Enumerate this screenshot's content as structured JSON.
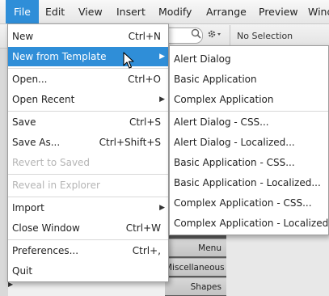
{
  "menubar": {
    "items": [
      "File",
      "Edit",
      "View",
      "Insert",
      "Modify",
      "Arrange",
      "Preview",
      "Wind"
    ]
  },
  "toolbar": {
    "no_selection": "No Selection"
  },
  "background_panel": {
    "items": [
      "Menu",
      "Miscellaneous",
      "Shapes"
    ]
  },
  "file_menu": {
    "items": [
      {
        "label": "New",
        "shortcut": "Ctrl+N"
      },
      {
        "label": "New from Template",
        "shortcut": "",
        "submenu": true,
        "highlighted": true
      },
      {
        "label": "Open...",
        "shortcut": "Ctrl+O"
      },
      {
        "label": "Open Recent",
        "shortcut": "",
        "submenu": true
      },
      {
        "label": "Save",
        "shortcut": "Ctrl+S"
      },
      {
        "label": "Save As...",
        "shortcut": "Ctrl+Shift+S"
      },
      {
        "label": "Revert to Saved",
        "shortcut": "",
        "disabled": true
      },
      {
        "label": "Reveal in Explorer",
        "shortcut": "",
        "disabled": true
      },
      {
        "label": "Import",
        "shortcut": "",
        "submenu": true
      },
      {
        "label": "Close Window",
        "shortcut": "Ctrl+W"
      },
      {
        "label": "Preferences...",
        "shortcut": "Ctrl+,"
      },
      {
        "label": "Quit",
        "shortcut": ""
      }
    ]
  },
  "template_submenu": {
    "items": [
      "Alert Dialog",
      "Basic Application",
      "Complex Application",
      "Alert Dialog - CSS...",
      "Alert Dialog - Localized...",
      "Basic Application - CSS...",
      "Basic Application - Localized...",
      "Complex Application - CSS...",
      "Complex Application - Localized..."
    ]
  },
  "icons": {
    "submenu_arrow": "chevron-right-icon",
    "cursor": "mouse-pointer-icon",
    "search": "search-icon",
    "gear": "gear-icon"
  },
  "colors": {
    "accent": "#2f8ed8",
    "disabled_text": "#b5b5b5"
  }
}
